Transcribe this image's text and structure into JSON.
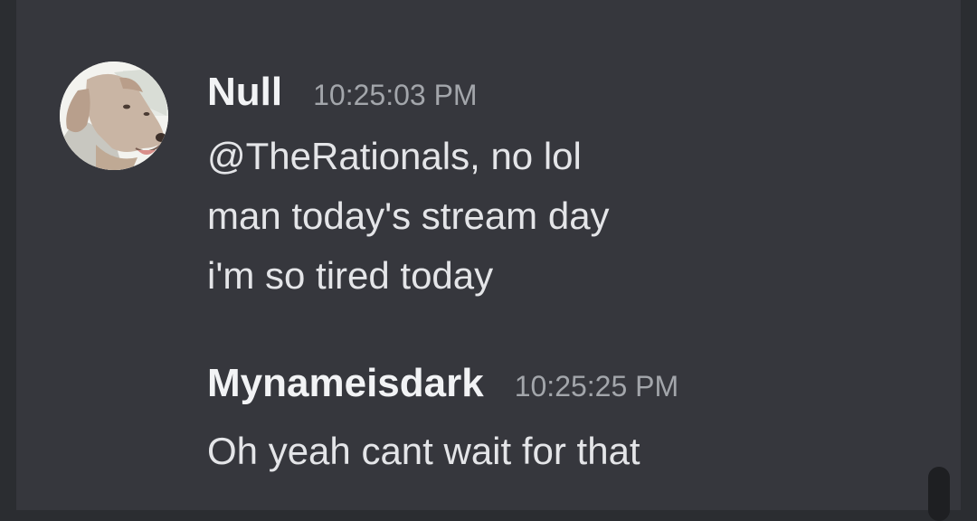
{
  "messages": [
    {
      "username": "Null",
      "timestamp": "10:25:03 PM",
      "avatar_icon": "dog-avatar-icon",
      "lines": [
        "@TheRationals, no lol",
        "man today's stream day",
        "i'm so tired today"
      ]
    },
    {
      "username": "Mynameisdark",
      "timestamp": "10:25:25 PM",
      "lines": [
        "Oh yeah cant wait for that"
      ]
    }
  ],
  "colors": {
    "background": "#36373d",
    "username": "#f2f3f5",
    "timestamp": "#a3a6ab",
    "message_text": "#e4e5e8"
  }
}
